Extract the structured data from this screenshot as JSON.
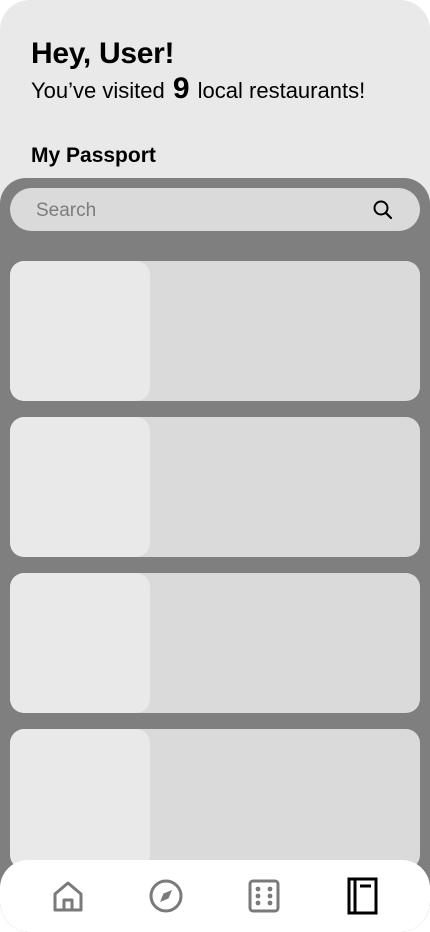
{
  "header": {
    "greeting": "Hey, User!",
    "visited_prefix": "You’ve visited",
    "visited_count": "9",
    "visited_suffix": "local restaurants!"
  },
  "passport": {
    "title": "My Passport",
    "search_placeholder": "Search",
    "cards": [
      {},
      {},
      {},
      {}
    ]
  },
  "bottom_nav": {
    "items": [
      {
        "icon": "home-icon",
        "active": false
      },
      {
        "icon": "compass-icon",
        "active": false
      },
      {
        "icon": "dice-icon",
        "active": false
      },
      {
        "icon": "passport-book-icon",
        "active": true
      }
    ]
  },
  "colors": {
    "background": "#e9e9e9",
    "panel": "#7f7f7f",
    "card": "#dadada",
    "thumbnail": "#e9e9e9",
    "nav_background": "#ffffff",
    "nav_inactive": "#7a7a7a",
    "nav_active": "#000000"
  }
}
